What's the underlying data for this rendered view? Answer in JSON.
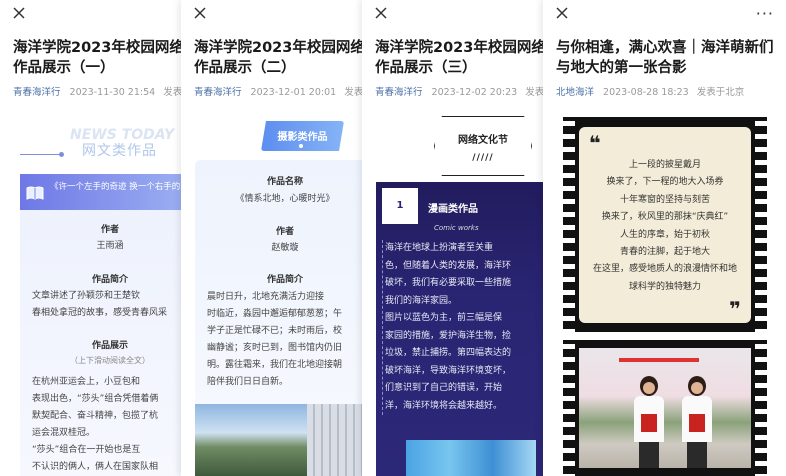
{
  "cards": [
    {
      "title": "海洋学院2023年校园网络文\n作品展示（一）",
      "account": "青春海洋行",
      "date": "2023-11-30 21:54",
      "from": "发表于",
      "decor_text": "NEWS TODAY",
      "section_title": "网文类作品",
      "bar_text": "《许一个左手的奇迹 换一个右手的",
      "author_label": "作者",
      "author": "王雨涵",
      "intro_label": "作品简介",
      "intro": "文章讲述了孙颖莎和王楚钦\n春相处拿冠的故事，感受青春风采",
      "show_label": "作品展示",
      "scroll_hint": "（上下滑动阅读全文）",
      "body": "在杭州亚运会上，小豆包和\n表现出色，“莎头”组合凭借着俩\n默契配合、奋斗精神，包揽了杭\n运会混双桂冠。\n“莎头”组合在一开始也是互\n不认识的俩人，俩人在国家队相"
    },
    {
      "title": "海洋学院2023年校园网络文\n作品展示（二）",
      "account": "青春海洋行",
      "date": "2023-12-01 20:01",
      "from": "发表于",
      "badge": "摄影类作品",
      "name_label": "作品名称",
      "name": "《情系北地，心暖时光》",
      "author_label": "作者",
      "author": "赵敏璇",
      "intro_label": "作品简介",
      "intro": "晨时日升，北地充满活力迎接\n时临近，淼园中邂逅郁郁葱葱；午\n学子正是忙碌不已；未时雨后，校\n幽静谧；亥时已到，图书馆内仍旧\n明。露往霜来，我们在北地迎接朝\n陪伴我们日日自新。"
    },
    {
      "title": "海洋学院2023年校园网络文\n作品展示（三）",
      "account": "青春海洋行",
      "date": "2023-12-02 20:23",
      "from": "发表于",
      "badge": "网络文化节",
      "badge_bars": "/////",
      "number": "1",
      "category": "漫画类作品",
      "category_en": "Comic works",
      "body": "海洋在地球上扮演者至关重\n色，但随着人类的发展，海洋环\n破坏，我们有必要采取一些措施\n我们的海洋家园。\n图片以蓝色为主，前三幅是保\n家园的措施，爱护海洋生物，捡\n垃圾，禁止捕捞。第四幅表达的\n破坏海洋，导致海洋环境变坏，\n们意识到了自己的错误，开始\n洋，海洋环境将会越来越好。"
    },
    {
      "title": "与你相逢，满心欢喜｜海洋萌新们\n与地大的第一张合影",
      "account": "北地海洋",
      "date": "2023-08-28 18:23",
      "from": "发表于北京",
      "quote_open": "❝",
      "quote_close": "❞",
      "poem": "上一段的披星戴月\n换来了，下一程的地大入场券\n十年寒窗的坚持与刻苦\n换来了，秋风里的那抹“庆典红”\n人生的序章，始于初秋\n青春的注脚，起于地大\n在这里，感受地质人的浪漫情怀和地\n球科学的独特魅力"
    }
  ],
  "icons": {
    "close": "close-icon",
    "more": "more-icon"
  },
  "more_glyph": "···",
  "colors": {
    "account": "#4a6fa5",
    "meta": "#9a9a9a",
    "card3_bg": "#2a2573",
    "badge2": "#5d8df0"
  }
}
